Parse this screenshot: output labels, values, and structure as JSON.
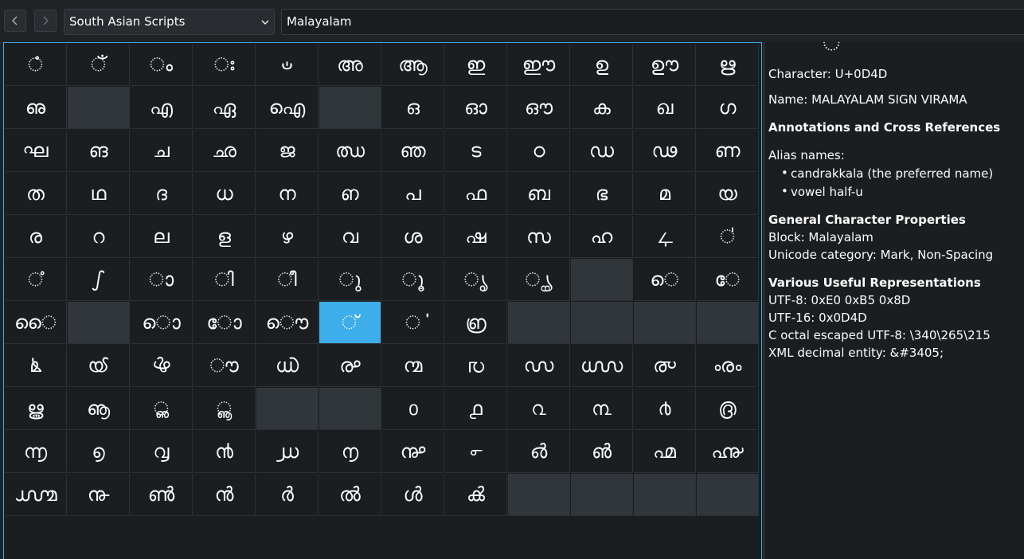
{
  "toolbar": {
    "back_icon": "chevron-left-icon",
    "forward_icon": "chevron-right-icon",
    "script_group": "South Asian Scripts",
    "block_search": "Malayalam"
  },
  "grid": {
    "columns": 12,
    "rows": [
      [
        "ഀ",
        "ഁ",
        "ം",
        "ഃ",
        "ഄ",
        "അ",
        "ആ",
        "ഇ",
        "ഈ",
        "ഉ",
        "ഊ",
        "ഋ"
      ],
      [
        "ഌ",
        "",
        "എ",
        "ഏ",
        "ഐ",
        "",
        "ഒ",
        "ഓ",
        "ഔ",
        "ക",
        "ഖ",
        "ഗ"
      ],
      [
        "ഘ",
        "ങ",
        "ച",
        "ഛ",
        "ജ",
        "ഝ",
        "ഞ",
        "ട",
        "ഠ",
        "ഡ",
        "ഢ",
        "ണ"
      ],
      [
        "ത",
        "ഥ",
        "ദ",
        "ധ",
        "ന",
        "ഩ",
        "പ",
        "ഫ",
        "ബ",
        "ഭ",
        "മ",
        "യ"
      ],
      [
        "ര",
        "റ",
        "ല",
        "ള",
        "ഴ",
        "വ",
        "ശ",
        "ഷ",
        "സ",
        "ഹ",
        "ഺ",
        "഻"
      ],
      [
        "഼",
        "ഽ",
        "ാ",
        "ി",
        "ീ",
        "ു",
        "ൂ",
        "ൃ",
        "ൄ",
        "",
        "െ",
        "േ"
      ],
      [
        "ൈ",
        "",
        "ൊ",
        "ോ",
        "ൌ",
        "്",
        "ൎ",
        "൏",
        "",
        "",
        "",
        ""
      ],
      [
        "ൔ",
        "ൕ",
        "ൖ",
        "ൗ",
        "൘",
        "൙",
        "൚",
        "൛",
        "൜",
        "൝",
        "൞",
        "ൟ"
      ],
      [
        "ൠ",
        "ൡ",
        "ൢ",
        "ൣ",
        "",
        "",
        "൦",
        "൧",
        "൨",
        "൩",
        "൪",
        "൫"
      ],
      [
        "൬",
        "൭",
        "൮",
        "൯",
        "൰",
        "൱",
        "൲",
        "൳",
        "൴",
        "൵",
        "൶",
        "൷"
      ],
      [
        "൸",
        "൹",
        "ൺ",
        "ൻ",
        "ർ",
        "ൽ",
        "ൾ",
        "ൿ",
        "",
        "",
        "",
        ""
      ]
    ],
    "selected": {
      "row": 6,
      "col": 5
    }
  },
  "details": {
    "glyph_peek": "്",
    "character_line": "Character:  U+0D4D",
    "name_line": "Name: MALAYALAM SIGN VIRAMA",
    "annotations_heading": "Annotations and Cross References",
    "alias_label": "Alias names:",
    "aliases": [
      "candrakkala (the preferred name)",
      "vowel half-u"
    ],
    "properties_heading": "General Character Properties",
    "block_line": "Block: Malayalam",
    "category_line": "Unicode category: Mark, Non-Spacing",
    "representations_heading": "Various Useful Representations",
    "utf8_line": "UTF-8: 0xE0 0xB5 0x8D",
    "utf16_line": "UTF-16: 0x0D4D",
    "octal_line": "C octal escaped UTF-8: \\340\\265\\215",
    "xml_line": "XML decimal entity: &#3405;"
  },
  "colors": {
    "selection": "#3daee9",
    "background": "#1b1e20",
    "empty_cell": "#31363b"
  }
}
